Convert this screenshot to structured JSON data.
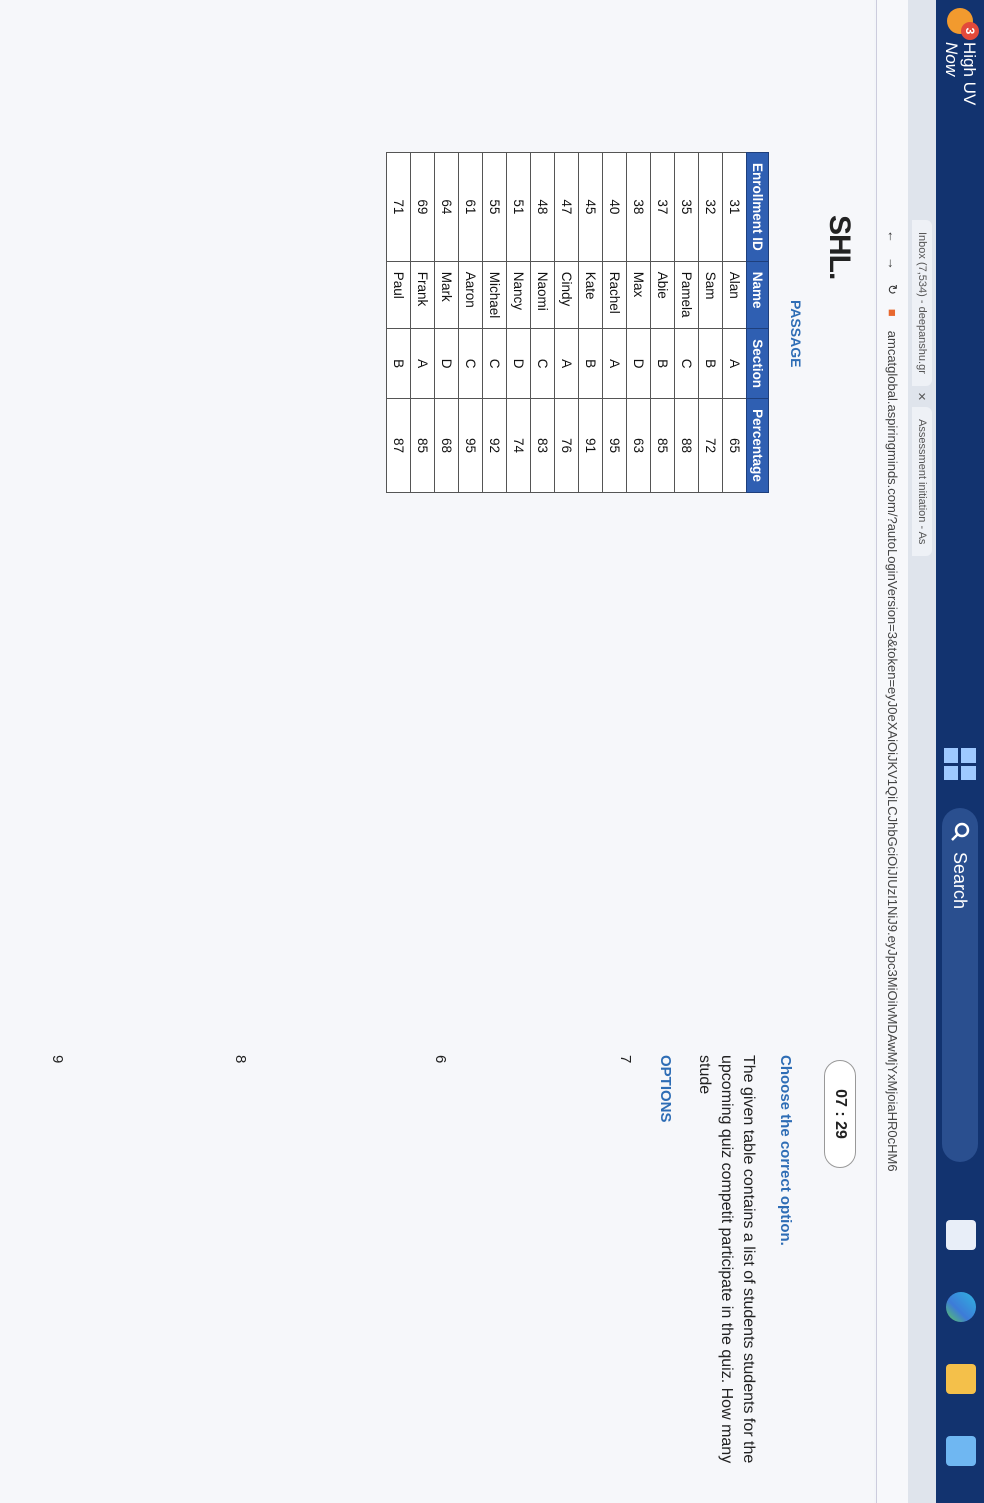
{
  "taskbar": {
    "weather_badge": "3",
    "weather_condition": "High UV",
    "weather_time": "Now",
    "search_label": "Search"
  },
  "browser": {
    "tab1": "Inbox (7,534) - deepanshu.gr",
    "tab2": "Assessment initiation - As",
    "url": "amcatglobal.aspiringminds.com/?autoLoginVersion=3&token=eyJ0eXAiOiJKV1QiLCJhbGciOiJIUzI1NiJ9.eyJpc3MiOiIvMDAwMjYxMjoiaHR0cHM6"
  },
  "page": {
    "logo": "SHL.",
    "timer": "07 : 29",
    "passage_label": "PASSAGE",
    "instruction": "Choose the correct option.",
    "question": "The given table contains a list of students students for the upcoming quiz competit participate in the quiz. How many stude",
    "options_label": "OPTIONS",
    "options": [
      "7",
      "6",
      "8",
      "9"
    ]
  },
  "table": {
    "headers": [
      "Enrollment ID",
      "Name",
      "Section",
      "Percentage"
    ],
    "rows": [
      [
        "31",
        "Alan",
        "A",
        "65"
      ],
      [
        "32",
        "Sam",
        "B",
        "72"
      ],
      [
        "35",
        "Pamela",
        "C",
        "88"
      ],
      [
        "37",
        "Abie",
        "B",
        "85"
      ],
      [
        "38",
        "Max",
        "D",
        "63"
      ],
      [
        "40",
        "Rachel",
        "A",
        "95"
      ],
      [
        "45",
        "Kate",
        "B",
        "91"
      ],
      [
        "47",
        "Cindy",
        "A",
        "76"
      ],
      [
        "48",
        "Naomi",
        "C",
        "83"
      ],
      [
        "51",
        "Nancy",
        "D",
        "74"
      ],
      [
        "55",
        "Michael",
        "C",
        "92"
      ],
      [
        "61",
        "Aaron",
        "C",
        "95"
      ],
      [
        "64",
        "Mark",
        "D",
        "68"
      ],
      [
        "69",
        "Frank",
        "A",
        "85"
      ],
      [
        "71",
        "Paul",
        "B",
        "87"
      ]
    ]
  },
  "colors": {
    "accent": "#2e6db5",
    "table_header": "#2f5fb2",
    "taskbar": "#12336f"
  }
}
